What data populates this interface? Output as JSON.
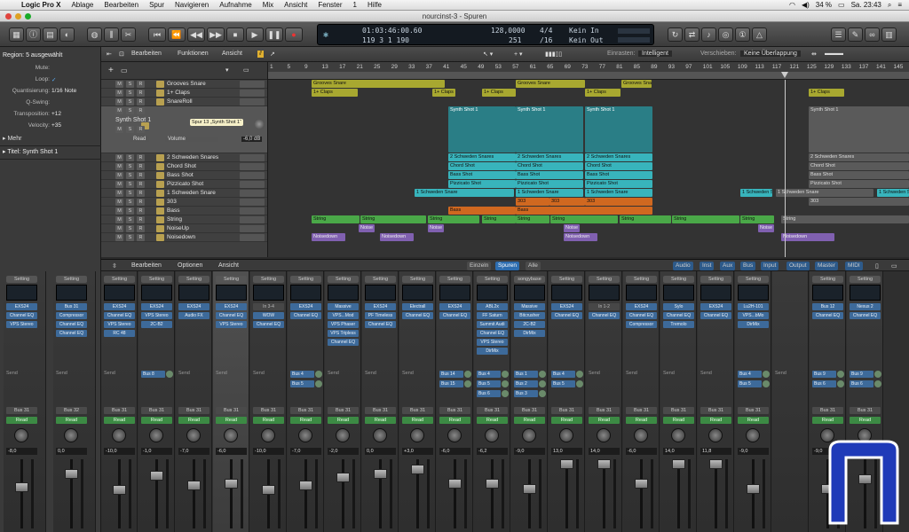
{
  "menubar": {
    "app": "Logic Pro X",
    "items": [
      "Ablage",
      "Bearbeiten",
      "Spur",
      "Navigieren",
      "Aufnahme",
      "Mix",
      "Ansicht",
      "Fenster",
      "1",
      "Hilfe"
    ],
    "battery": "34 %",
    "clock": "Sa. 23:43"
  },
  "window": {
    "title": "nourcinst-3 - Spuren"
  },
  "lcd": {
    "time": "01:03:46:00.60",
    "bars": "119  3  1  190",
    "bpm": "128,0000",
    "bpm_small": "251",
    "sig": "4/4",
    "div": "/16",
    "in": "Kein In",
    "out": "Kein Out"
  },
  "inspector": {
    "region_header": "Region: 5 ausgewählt",
    "rows": [
      {
        "k": "Mute:",
        "v": ""
      },
      {
        "k": "Loop:",
        "v": "✓"
      },
      {
        "k": "Quantisierung:",
        "v": "1/16 Note"
      },
      {
        "k": "Q-Swing:",
        "v": ""
      },
      {
        "k": "Transposition:",
        "v": "+12"
      },
      {
        "k": "Velocity:",
        "v": "+35"
      }
    ],
    "more": "Mehr",
    "track_header": "Titel: Synth Shot 1"
  },
  "tracks_toolbar": {
    "edit": "Bearbeiten",
    "functions": "Funktionen",
    "view": "Ansicht",
    "snap_label": "Einrasten:",
    "snap_value": "Intelligent",
    "move_label": "Verschieben:",
    "move_value": "Keine Überlappung"
  },
  "ruler": [
    "1",
    "5",
    "9",
    "13",
    "17",
    "21",
    "25",
    "29",
    "33",
    "37",
    "41",
    "45",
    "49",
    "53",
    "57",
    "61",
    "65",
    "69",
    "73",
    "77",
    "81",
    "85",
    "89",
    "93",
    "97",
    "101",
    "105",
    "109",
    "113",
    "117",
    "121",
    "125",
    "129",
    "133",
    "137",
    "141",
    "145"
  ],
  "tracks": [
    {
      "name": "Grooves Snare"
    },
    {
      "name": "1+ Claps"
    },
    {
      "name": "SnareRoll"
    },
    {
      "name": "Synth Shot 1"
    },
    {
      "name": "2 Schweden Snares"
    },
    {
      "name": "Chord Shot"
    },
    {
      "name": "Bass Shot"
    },
    {
      "name": "Pizzicato Shot"
    },
    {
      "name": "1 Schweden Snare"
    },
    {
      "name": "303"
    },
    {
      "name": "Bass"
    },
    {
      "name": "String"
    },
    {
      "name": "NoiseUp"
    },
    {
      "name": "Noisedown"
    }
  ],
  "selected_track": {
    "name": "Synth Shot 1",
    "tooltip": "Spur 13 „Synth Shot 1“",
    "read": "Read",
    "volume": "Volume",
    "db": "-6,0 dB"
  },
  "regions": {
    "claps": "1+ Claps",
    "grooves": "Grooves Snare",
    "synth": "Synth Shot 1",
    "schweden2": "2 Schweden Snares",
    "chord": "Chord Shot",
    "bass_shot": "Bass Shot",
    "pizz": "Pizzicato Shot",
    "schweden1": "1 Schweden Snare",
    "r303": "303",
    "bass": "Bass",
    "string": "String",
    "noise": "Noise",
    "noisedown": "Noisedown"
  },
  "mixer_bar": {
    "edit": "Bearbeiten",
    "options": "Optionen",
    "view": "Ansicht",
    "single": "Einzeln",
    "tracks": "Spuren",
    "all": "Alle",
    "tabs": [
      "Audio",
      "Inst",
      "Aux",
      "Bus",
      "Input",
      "Output",
      "Master",
      "MIDI"
    ]
  },
  "left_strips": [
    {
      "set": "Setting",
      "slots": [
        "EXS24",
        "Channel EQ",
        "VPS Stereo"
      ],
      "out": "Bus 31",
      "read": "Read",
      "gain": "-8,0"
    },
    {
      "set": "Setting",
      "slots": [
        "Bus 31",
        "Compressor",
        "Channel EQ",
        "Channel EQ"
      ],
      "out": "Bus 32",
      "read": "Read",
      "gain": "0,0"
    }
  ],
  "strips": [
    {
      "set": "Setting",
      "slots": [
        "EXS24",
        "Channel EQ",
        "VPS Stereo",
        "RC 48"
      ],
      "sends": [],
      "out": "Bus 31",
      "gain": "-10,0"
    },
    {
      "set": "Setting",
      "slots": [
        "EXS24",
        "VPS Stereo",
        "2C-B2"
      ],
      "sends": [
        "Bus 8"
      ],
      "out": "Bus 31",
      "gain": "-1,0"
    },
    {
      "set": "Setting",
      "slots": [
        "EXS24",
        "Audio FX"
      ],
      "sends": [],
      "out": "Bus 31",
      "gain": "-7,0"
    },
    {
      "set": "Setting",
      "slots": [
        "EXS24",
        "Channel EQ",
        "VPS Stereo"
      ],
      "sends": [],
      "out": "Bus 31",
      "gain": "-6,0",
      "sel": true
    },
    {
      "set": "Setting",
      "slots": [
        "In 3-4",
        "WOW",
        "Channel EQ"
      ],
      "sends": [],
      "out": "Bus 31",
      "gain": "-10,0"
    },
    {
      "set": "Setting",
      "slots": [
        "EXS24",
        "Channel EQ"
      ],
      "sends": [
        "Bus 4",
        "Bus 5"
      ],
      "out": "Bus 31",
      "gain": "-7,0"
    },
    {
      "set": "Setting",
      "slots": [
        "Massive",
        "VPS...Mod",
        "VPS Phaser",
        "VPS Tripless",
        "Channel EQ"
      ],
      "sends": [],
      "out": "Bus 31",
      "gain": "-2,0"
    },
    {
      "set": "Setting",
      "slots": [
        "EXS24",
        "PF Timeless",
        "Channel EQ"
      ],
      "sends": [],
      "out": "Bus 31",
      "gain": "0,0"
    },
    {
      "set": "Setting",
      "slots": [
        "Electrall",
        "Channel EQ"
      ],
      "sends": [],
      "out": "Bus 31",
      "gain": "+3,0"
    },
    {
      "set": "Setting",
      "slots": [
        "EXS24",
        "Channel EQ"
      ],
      "sends": [
        "Bus 14",
        "Bus 15"
      ],
      "out": "Bus 31",
      "gain": "-6,0"
    },
    {
      "set": "Setting",
      "slots": [
        "ABL2x",
        "FF Saturn",
        "Summit Audi",
        "Channel EQ",
        "VPS Stereo",
        "DirMix"
      ],
      "sends": [
        "Bus 4",
        "Bus 5",
        "Bus 6"
      ],
      "out": "Bus 31",
      "gain": "-6,2"
    },
    {
      "set": "songybase",
      "slots": [
        "Massive",
        "Bitcrusher",
        "2C-B2",
        "DirMix"
      ],
      "sends": [
        "Bus 1",
        "Bus 2",
        "Bus 3"
      ],
      "out": "Bus 31",
      "gain": "-9,0"
    },
    {
      "set": "Setting",
      "slots": [
        "EXS24",
        "Channel EQ"
      ],
      "sends": [
        "Bus 4",
        "Bus 5"
      ],
      "out": "Bus 31",
      "gain": "13,0"
    },
    {
      "set": "Setting",
      "slots": [
        "In 1-2",
        "Channel EQ"
      ],
      "sends": [],
      "out": "Bus 31",
      "gain": "14,0"
    },
    {
      "set": "Setting",
      "slots": [
        "EXS24",
        "Channel EQ",
        "Compressor"
      ],
      "sends": [],
      "out": "Bus 31",
      "gain": "-6,0"
    },
    {
      "set": "Setting",
      "slots": [
        "Sylo",
        "Channel EQ",
        "Tremolo"
      ],
      "sends": [],
      "out": "Bus 31",
      "gain": "14,0"
    },
    {
      "set": "Setting",
      "slots": [
        "EXS24",
        "Channel EQ"
      ],
      "sends": [],
      "out": "Bus 31",
      "gain": "11,8"
    },
    {
      "set": "Setting",
      "slots": [
        "Lu2H-101",
        "VPS...bMo",
        "DirMix"
      ],
      "sends": [
        "Bus 4",
        "Bus 5"
      ],
      "out": "Bus 31",
      "gain": "-9,0"
    },
    {
      "set": "",
      "slots": [],
      "sends": [],
      "out": "",
      "gain": ""
    },
    {
      "set": "Setting",
      "slots": [
        "Bus 12",
        "Channel EQ"
      ],
      "sends": [
        "Bus 9",
        "Bus 6"
      ],
      "out": "Bus 31",
      "gain": "-9,0"
    },
    {
      "set": "Setting",
      "slots": [
        "Nexus 2",
        "Channel EQ"
      ],
      "sends": [
        "Bus 9",
        "Bus 6"
      ],
      "out": "Bus 31",
      "gain": "-3,0"
    }
  ],
  "common": {
    "read": "Read",
    "send": "Send"
  }
}
